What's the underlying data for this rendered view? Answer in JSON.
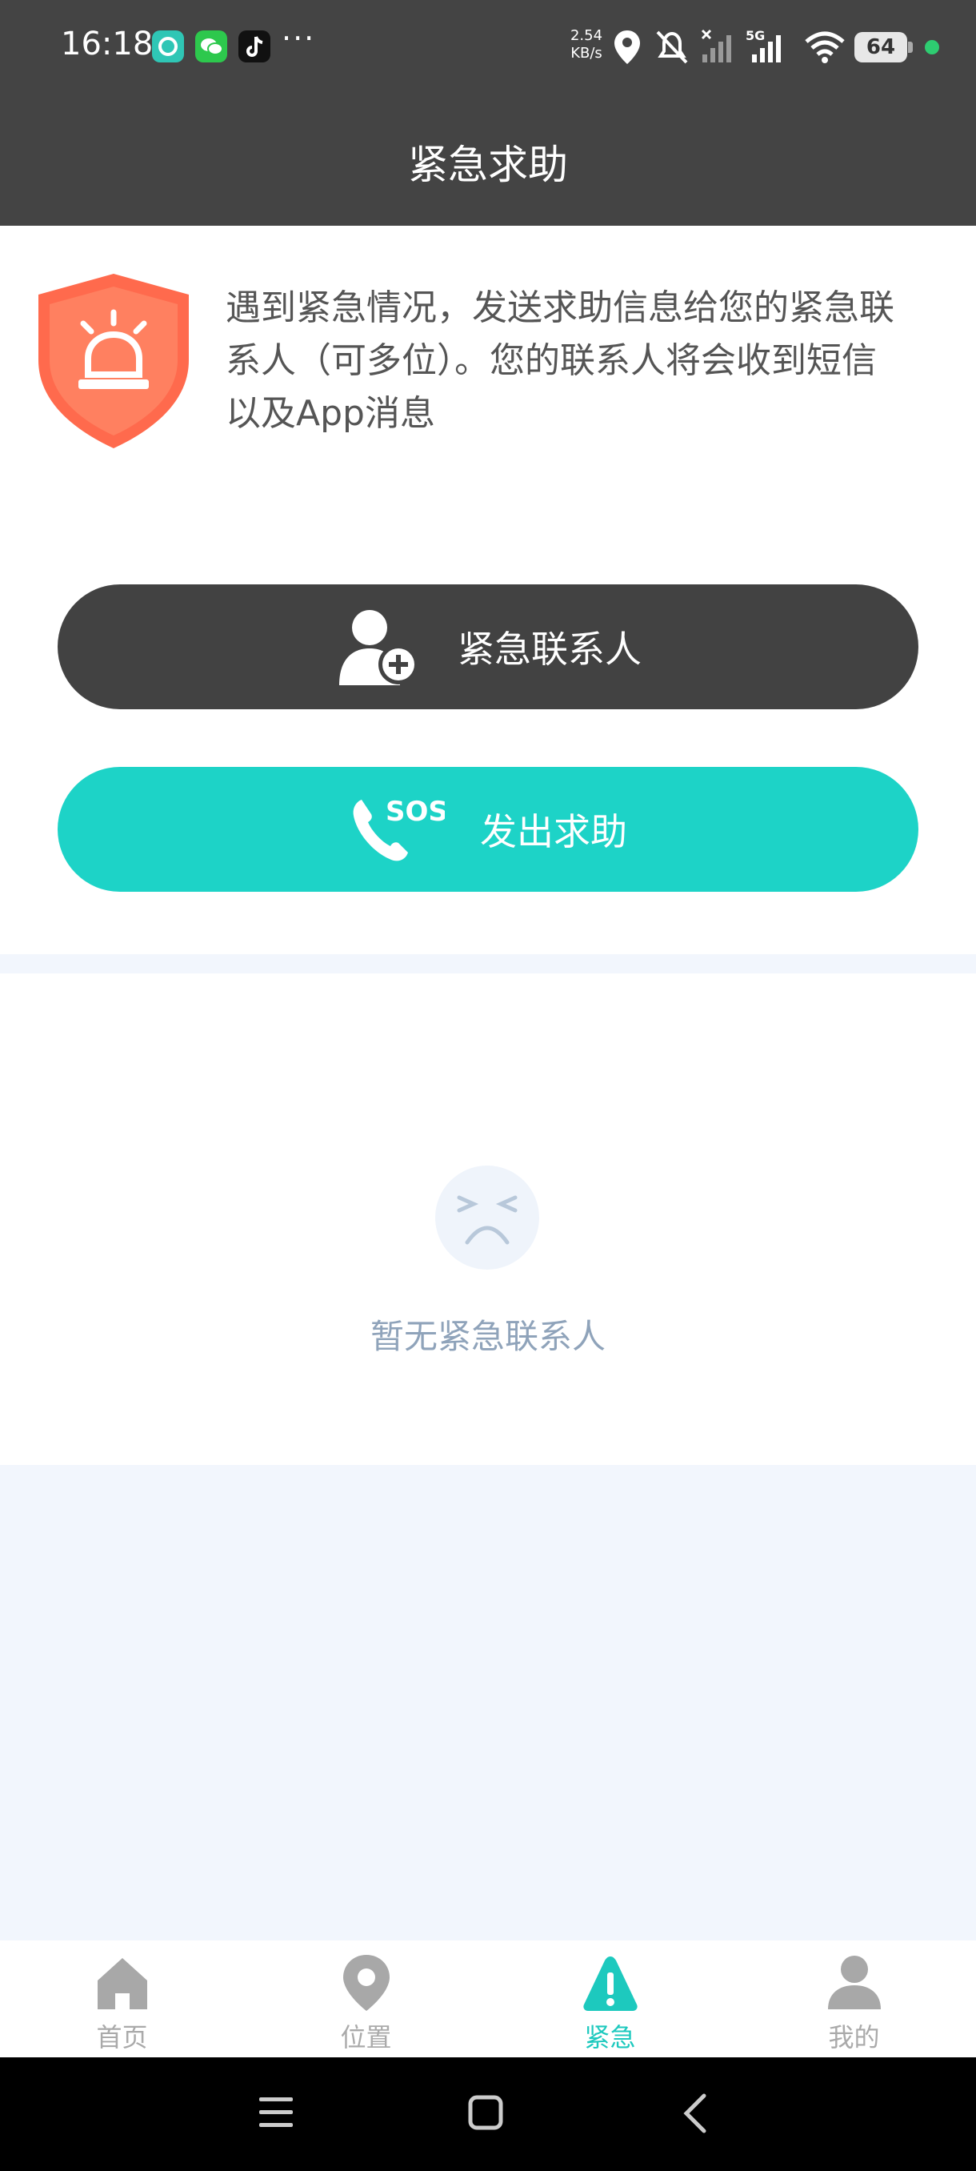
{
  "status_bar": {
    "time": "16:18",
    "speed_value": "2.54",
    "speed_unit": "KB/s",
    "network": "5G",
    "battery": "64",
    "icons": [
      "healthkit-app-icon",
      "wechat-app-icon",
      "tiktok-app-icon",
      "more-dots-icon",
      "location-icon",
      "mute-icon",
      "signal-off-icon",
      "signal-5g-icon",
      "wifi-icon",
      "battery-icon"
    ],
    "more": "···"
  },
  "header": {
    "title": "紧急求助"
  },
  "intro": {
    "icon": "alarm-shield-icon",
    "text": "遇到紧急情况，发送求助信息给您的紧急联系人（可多位）。您的联系人将会收到短信以及App消息"
  },
  "buttons": {
    "contacts_label": "紧急联系人",
    "contacts_icon": "add-contact-icon",
    "sos_label": "发出求助",
    "sos_icon": "sos-phone-icon",
    "sos_text": "SOS"
  },
  "empty_state": {
    "icon": "sad-face-icon",
    "text": "暂无紧急联系人"
  },
  "tabs": [
    {
      "label": "首页",
      "icon": "home-icon",
      "active": false
    },
    {
      "label": "位置",
      "icon": "location-pin-icon",
      "active": false
    },
    {
      "label": "紧急",
      "icon": "warning-icon",
      "active": true
    },
    {
      "label": "我的",
      "icon": "profile-icon",
      "active": false
    }
  ],
  "colors": {
    "header_bg": "#444444",
    "accent": "#1DD3C7",
    "contact_button": "#424242",
    "shield": "#FF6A4D",
    "page_bg": "#F2F6FD",
    "empty_text": "#8FA3BA"
  },
  "system_nav": [
    "menu-icon",
    "home-square-icon",
    "back-icon"
  ]
}
